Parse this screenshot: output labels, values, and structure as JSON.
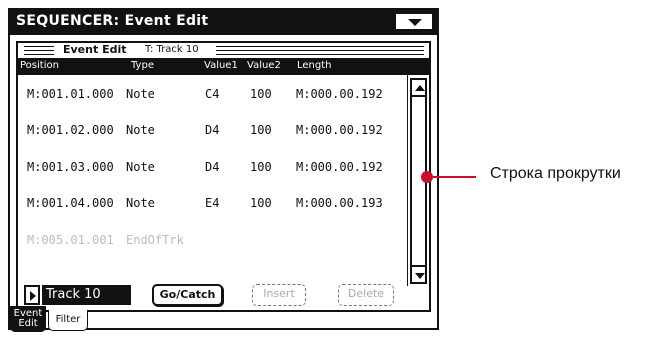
{
  "window": {
    "title": "SEQUENCER: Event Edit"
  },
  "panel": {
    "title": "Event Edit",
    "track_label": "T: Track 10"
  },
  "columns": [
    "Position",
    "Type",
    "Value1",
    "Value2",
    "Length"
  ],
  "events": [
    {
      "position": "M:001.01.000",
      "type": "Note",
      "value1": "C4",
      "value2": "100",
      "length": "M:000.00.192"
    },
    {
      "position": "M:001.02.000",
      "type": "Note",
      "value1": "D4",
      "value2": "100",
      "length": "M:000.00.192"
    },
    {
      "position": "M:001.03.000",
      "type": "Note",
      "value1": "D4",
      "value2": "100",
      "length": "M:000.00.192"
    },
    {
      "position": "M:001.04.000",
      "type": "Note",
      "value1": "E4",
      "value2": "100",
      "length": "M:000.00.193"
    },
    {
      "position": "M:005.01.001",
      "type": "EndOfTrk",
      "value1": "",
      "value2": "",
      "length": ""
    }
  ],
  "track_selector": {
    "value": "Track 10"
  },
  "buttons": {
    "go_catch": "Go/Catch",
    "insert": "Insert",
    "delete": "Delete"
  },
  "tabs": {
    "event_edit_line1": "Event",
    "event_edit_line2": "Edit",
    "filter": "Filter"
  },
  "callout": {
    "text": "Строка прокрутки",
    "color": "#c8102e"
  },
  "icons": [
    "menu-arrow-down-icon",
    "scroll-up-arrow-icon",
    "scroll-down-arrow-icon",
    "play-triangle-icon"
  ]
}
